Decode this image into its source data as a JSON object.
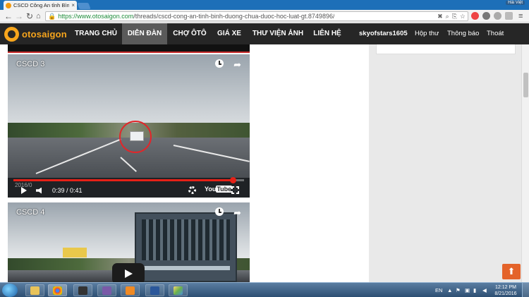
{
  "browser": {
    "tab_title": "CSCD Công An tỉnh Bình",
    "tab_close": "×",
    "url_host": "https://www.otosaigon.com",
    "url_path": "/threads/cscd-cong-an-tinh-binh-duong-chua-duoc-hoc-luat-gt.8749896/",
    "window_user": "Hải Việt"
  },
  "site": {
    "logo_text": "otosaigon",
    "menu": [
      {
        "label": "TRANG CHỦ"
      },
      {
        "label": "DIỄN ĐÀN",
        "active": true
      },
      {
        "label": "CHỢ ÔTÔ"
      },
      {
        "label": "GIÁ XE"
      },
      {
        "label": "THƯ VIỆN ẢNH"
      },
      {
        "label": "LIÊN HỆ"
      }
    ],
    "username": "skyofstars1605",
    "inbox": "Hộp thư",
    "notifications": "Thông báo",
    "logout": "Thoát"
  },
  "videos": [
    {
      "title": "CSCD 3",
      "time": "0:39 / 0:41",
      "progress": 0.95,
      "overlay_date": "2016/0",
      "youtube": "You",
      "youtube_tube": "Tube"
    },
    {
      "title": "CSCD 4"
    }
  ],
  "taskbar": {
    "lang": "EN",
    "time": "12:12 PM",
    "date": "8/21/2016"
  },
  "colors": {
    "brand_orange": "#f7a51c",
    "header_bg": "#262626",
    "active_menu": "#5a5a5a",
    "progress_red": "#e62117",
    "scroll_btn": "#e4632a"
  }
}
